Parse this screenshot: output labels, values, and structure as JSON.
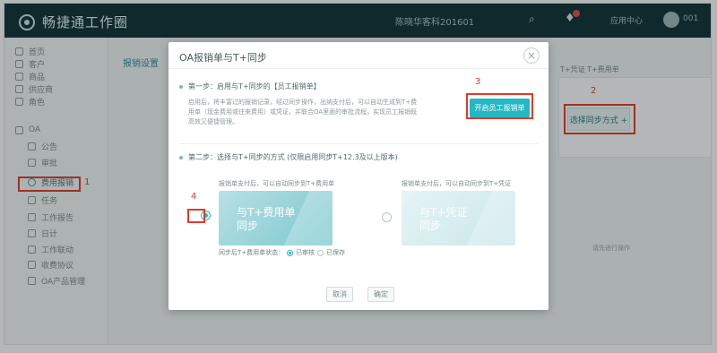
{
  "app": {
    "name": "畅捷通工作圈"
  },
  "topbar": {
    "company": "陈晓华客科201601",
    "app_label": "应用中心",
    "user": "001"
  },
  "sidebar": {
    "items": [
      {
        "label": "首页"
      },
      {
        "label": "客户"
      },
      {
        "label": "商品"
      },
      {
        "label": "供应商"
      },
      {
        "label": "角色"
      },
      {
        "label": "OA"
      },
      {
        "label": "公告"
      },
      {
        "label": "审批"
      },
      {
        "label": "费用报销"
      },
      {
        "label": "任务"
      },
      {
        "label": "工作报告"
      },
      {
        "label": "日计"
      },
      {
        "label": "工作联动"
      },
      {
        "label": "收费协议"
      },
      {
        "label": "OA产品管理"
      }
    ],
    "annotation_number": "1"
  },
  "content": {
    "page_tab": "报销设置",
    "right_link": "T+凭证    T+费用单",
    "right_button": "选择同步方式 +",
    "annotation_number": "2",
    "bg_note": "请先进行操作"
  },
  "modal": {
    "title": "OA报销单与T+同步",
    "close_icon": "×",
    "step1_title": "第一步：启用与T+同步的【员工报销单】",
    "step1_desc": "启用后，将丰富过的报销记录，经过同步操作，出纳支付后，可以自动生成到T+费用单（现金费用或往来费用）或凭证，并联合OA里面的审批流程，实现员工报销既高效又便捷管理。",
    "open_button": "开启员工报销单",
    "annotation_3": "3",
    "step2_title": "第二步：选择与T+同步的方式  (仅限启用同步T+12.3及以上版本)",
    "option1_caption": "报销单支付后，可以自动同步到T+费用单",
    "option1_label_line1": "与T+费用单",
    "option1_label_line2": "同步",
    "option2_caption": "报销单支付后，可以自动同步到T+凭证",
    "option2_label_line1": "与T+凭证",
    "option2_label_line2": "同步",
    "annotation_4": "4",
    "sync_status_label": "同步后T+费用单状态：",
    "status_option1": "已审核",
    "status_option2": "已保存",
    "cancel_button": "取消",
    "confirm_button": "确定"
  },
  "colors": {
    "topbar": "#0f2f33",
    "accent": "#23b8c4",
    "annotation": "#e03a2c"
  }
}
